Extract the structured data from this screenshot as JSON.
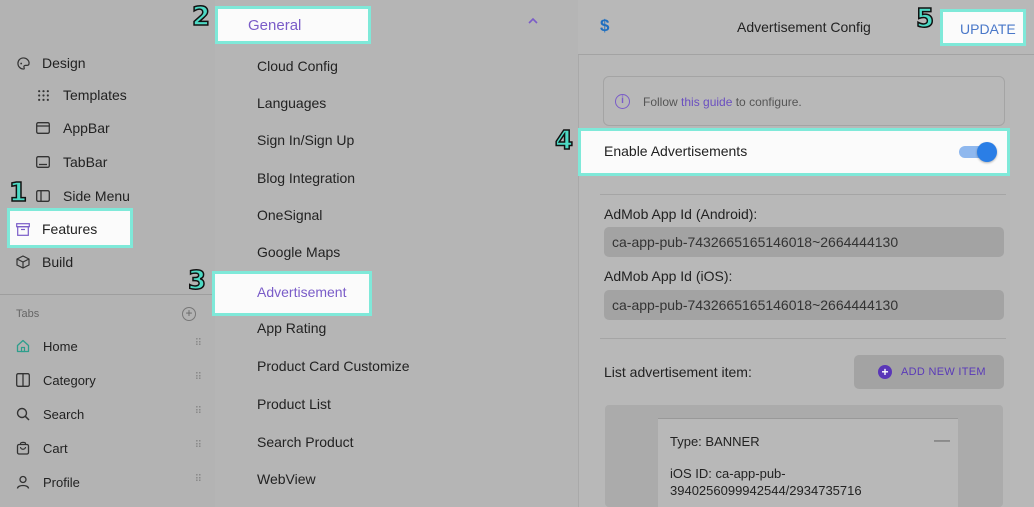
{
  "sidebar": {
    "items": [
      {
        "label": "Design",
        "icon": "palette-icon"
      },
      {
        "label": "Templates",
        "icon": "grid-dots-icon"
      },
      {
        "label": "AppBar",
        "icon": "appbar-icon"
      },
      {
        "label": "TabBar",
        "icon": "tabbar-icon"
      },
      {
        "label": "Side Menu",
        "icon": "side-menu-icon"
      },
      {
        "label": "Features",
        "icon": "archive-icon"
      },
      {
        "label": "Build",
        "icon": "cube-icon"
      }
    ],
    "tabs_label": "Tabs",
    "tabs": [
      {
        "label": "Home",
        "icon": "home-icon"
      },
      {
        "label": "Category",
        "icon": "category-icon"
      },
      {
        "label": "Search",
        "icon": "search-icon"
      },
      {
        "label": "Cart",
        "icon": "cart-icon"
      },
      {
        "label": "Profile",
        "icon": "profile-icon"
      }
    ]
  },
  "middle": {
    "section_title": "General",
    "items": [
      "Cloud Config",
      "Languages",
      "Sign In/Sign Up",
      "Blog Integration",
      "OneSignal",
      "Google Maps",
      "Advertisement",
      "App Rating",
      "Product Card Customize",
      "Product List",
      "Search Product",
      "WebView"
    ]
  },
  "header": {
    "icon_glyph": "$",
    "title": "Advertisement Config",
    "update_label": "UPDATE"
  },
  "info": {
    "prefix": "Follow ",
    "link": "this guide",
    "suffix": " to configure."
  },
  "enable": {
    "label": "Enable Advertisements",
    "enabled": true
  },
  "fields": {
    "android_label": "AdMob App Id (Android):",
    "android_value": "ca-app-pub-7432665165146018~2664444130",
    "ios_label": "AdMob App Id (iOS):",
    "ios_value": "ca-app-pub-7432665165146018~2664444130"
  },
  "list": {
    "label": "List advertisement item:",
    "add_label": "ADD NEW ITEM",
    "card_type": "Type: BANNER",
    "card_ios": "iOS ID: ca-app-pub-3940256099942544/2934735716"
  },
  "badges": [
    "1",
    "2",
    "3",
    "4",
    "5"
  ],
  "colors": {
    "highlight_border": "#7fe9d9",
    "accent_purple": "#7a5cc8",
    "toggle_blue": "#2a7ee6",
    "update_blue": "#4a78c9"
  }
}
